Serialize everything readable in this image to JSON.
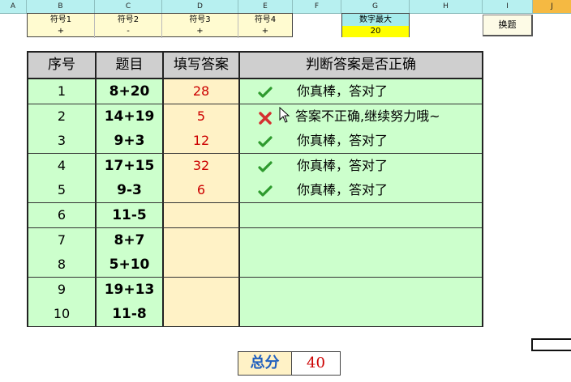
{
  "columns": [
    "A",
    "B",
    "C",
    "D",
    "E",
    "F",
    "G",
    "H",
    "I",
    "J"
  ],
  "active_column": "J",
  "symbols": [
    {
      "label": "符号1",
      "value": "+"
    },
    {
      "label": "符号2",
      "value": "-"
    },
    {
      "label": "符号3",
      "value": "+"
    },
    {
      "label": "符号4",
      "value": "+"
    }
  ],
  "max_number": {
    "label": "数字最大",
    "value": "20"
  },
  "refresh_button": "换题",
  "table": {
    "headers": [
      "序号",
      "题目",
      "填写答案",
      "判断答案是否正确"
    ],
    "rows": [
      {
        "no": "1",
        "question": "8+20",
        "answer": "28",
        "status": "correct",
        "judgement": "你真棒，答对了"
      },
      {
        "no": "2",
        "question": "14+19",
        "answer": "5",
        "status": "wrong",
        "judgement": "答案不正确,继续努力哦~"
      },
      {
        "no": "3",
        "question": "9+3",
        "answer": "12",
        "status": "correct",
        "judgement": "你真棒，答对了"
      },
      {
        "no": "4",
        "question": "17+15",
        "answer": "32",
        "status": "correct",
        "judgement": "你真棒，答对了"
      },
      {
        "no": "5",
        "question": "9-3",
        "answer": "6",
        "status": "correct",
        "judgement": "你真棒，答对了"
      },
      {
        "no": "6",
        "question": "11-5",
        "answer": "",
        "status": "",
        "judgement": ""
      },
      {
        "no": "7",
        "question": "8+7",
        "answer": "",
        "status": "",
        "judgement": ""
      },
      {
        "no": "8",
        "question": "5+10",
        "answer": "",
        "status": "",
        "judgement": ""
      },
      {
        "no": "9",
        "question": "19+13",
        "answer": "",
        "status": "",
        "judgement": ""
      },
      {
        "no": "10",
        "question": "11-8",
        "answer": "",
        "status": "",
        "judgement": ""
      }
    ]
  },
  "score": {
    "label": "总分",
    "value": "40"
  },
  "colors": {
    "correct": "#2e9a2e",
    "wrong": "#d43030",
    "score_label": "#1f5fbf",
    "answer": "#cc0000"
  },
  "icons": {
    "correct": "check-icon",
    "wrong": "cross-icon"
  }
}
